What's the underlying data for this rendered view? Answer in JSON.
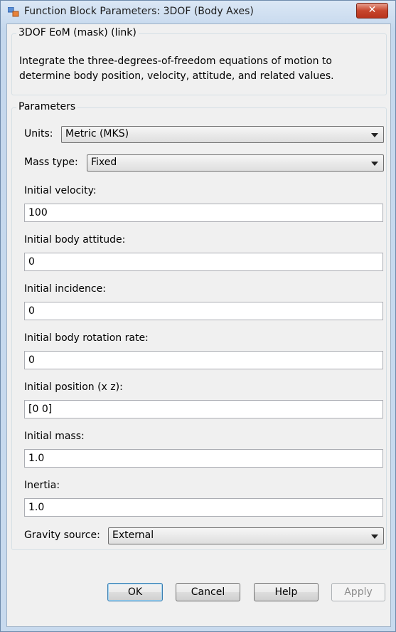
{
  "window": {
    "title": "Function Block Parameters: 3DOF (Body Axes)",
    "close_glyph": "✕"
  },
  "block": {
    "header": "3DOF EoM (mask) (link)",
    "description": "Integrate the three-degrees-of-freedom equations of motion to determine body position, velocity, attitude, and related values."
  },
  "parameters": {
    "legend": "Parameters",
    "units": {
      "label": "Units:",
      "value": "Metric (MKS)"
    },
    "mass_type": {
      "label": "Mass type:",
      "value": "Fixed"
    },
    "initial_velocity": {
      "label": "Initial velocity:",
      "value": "100"
    },
    "initial_body_attitude": {
      "label": "Initial body attitude:",
      "value": "0"
    },
    "initial_incidence": {
      "label": "Initial incidence:",
      "value": "0"
    },
    "initial_body_rotation_rate": {
      "label": "Initial body rotation rate:",
      "value": "0"
    },
    "initial_position": {
      "label": "Initial position (x z):",
      "value": "[0 0]"
    },
    "initial_mass": {
      "label": "Initial mass:",
      "value": "1.0"
    },
    "inertia": {
      "label": "Inertia:",
      "value": "1.0"
    },
    "gravity_source": {
      "label": "Gravity source:",
      "value": "External"
    }
  },
  "buttons": {
    "ok": "OK",
    "cancel": "Cancel",
    "help": "Help",
    "apply": "Apply"
  }
}
